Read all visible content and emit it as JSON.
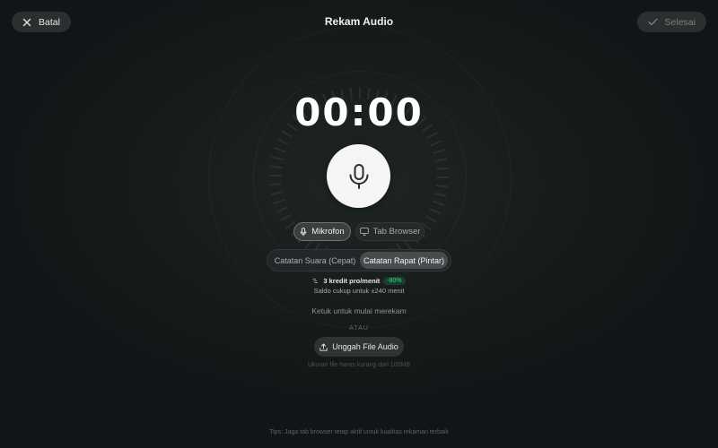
{
  "header": {
    "cancel_label": "Batal",
    "title": "Rekam Audio",
    "done_label": "Selesai"
  },
  "recorder": {
    "timer": "00:00",
    "mic_button_icon": "microphone-icon"
  },
  "sources": [
    {
      "label": "Mikrofon",
      "icon": "microphone-icon",
      "selected": true
    },
    {
      "label": "Tab Browser",
      "icon": "monitor-icon",
      "selected": false
    }
  ],
  "modes": [
    {
      "label": "Catatan Suara (Cepat)",
      "selected": false
    },
    {
      "label": "Catatan Rapat (Pintar)",
      "selected": true
    }
  ],
  "credits": {
    "icon": "coins-icon",
    "rate": "3 kredit pro/menit",
    "discount": "-80%",
    "balance": "Saldo cukup untuk ±240 menit"
  },
  "hint": "Ketuk untuk mulai merekam",
  "divider_label": "ATAU",
  "upload": {
    "label": "Unggah File Audio",
    "icon": "upload-icon",
    "limit_note": "Ukuran file harus kurang dari 100MB"
  },
  "tips": "Tips: Jaga tab browser tetap aktif untuk kualitas rekaman terbaik",
  "colors": {
    "background": "#171c1b",
    "accent_badge_text": "#3fd27e",
    "accent_badge_bg": "#17402c"
  }
}
